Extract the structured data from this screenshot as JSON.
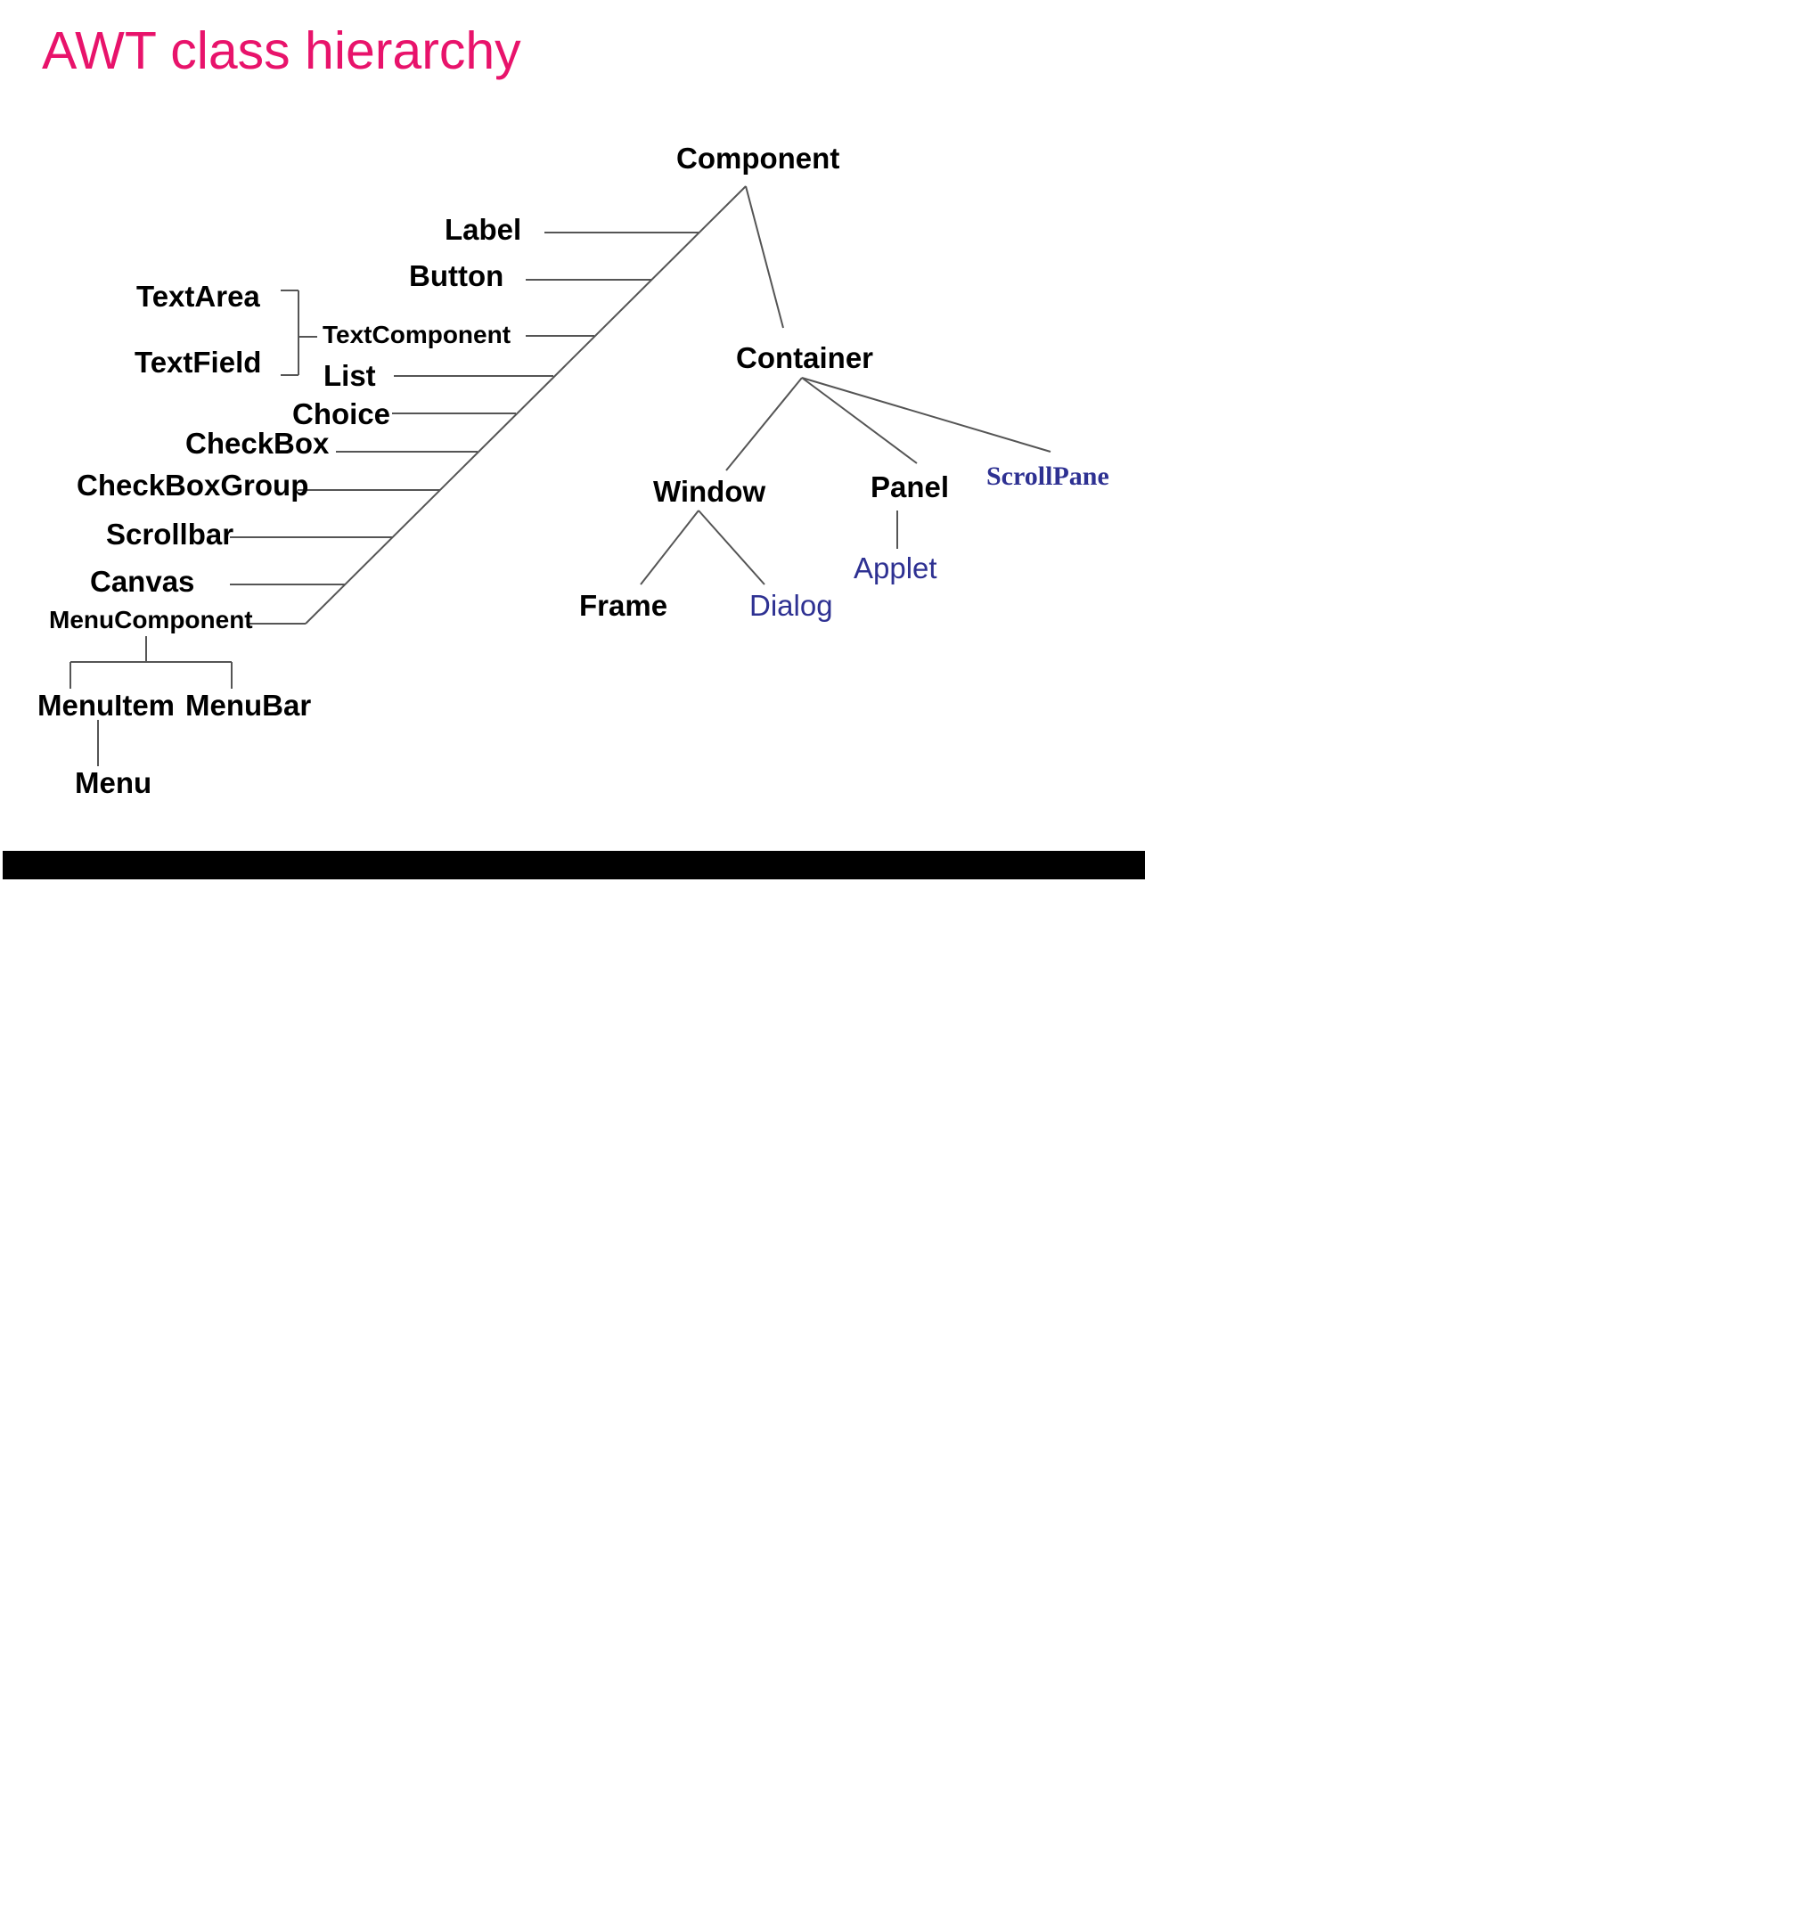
{
  "title": "AWT class hierarchy",
  "colors": {
    "title": "#e8136b",
    "text": "#000000",
    "highlight": "#2e3192",
    "line": "#555555"
  },
  "nodes": {
    "component": "Component",
    "label": "Label",
    "button": "Button",
    "text_area": "TextArea",
    "text_field": "TextField",
    "text_component": "TextComponent",
    "list": "List",
    "choice": "Choice",
    "check_box": "CheckBox",
    "check_box_group": "CheckBoxGroup",
    "scrollbar": "Scrollbar",
    "canvas": "Canvas",
    "menu_component": "MenuComponent",
    "menu_item": "MenuItem",
    "menu_bar": "MenuBar",
    "menu": "Menu",
    "container": "Container",
    "window": "Window",
    "panel": "Panel",
    "scroll_pane": "ScrollPane",
    "applet": "Applet",
    "frame": "Frame",
    "dialog": "Dialog"
  }
}
